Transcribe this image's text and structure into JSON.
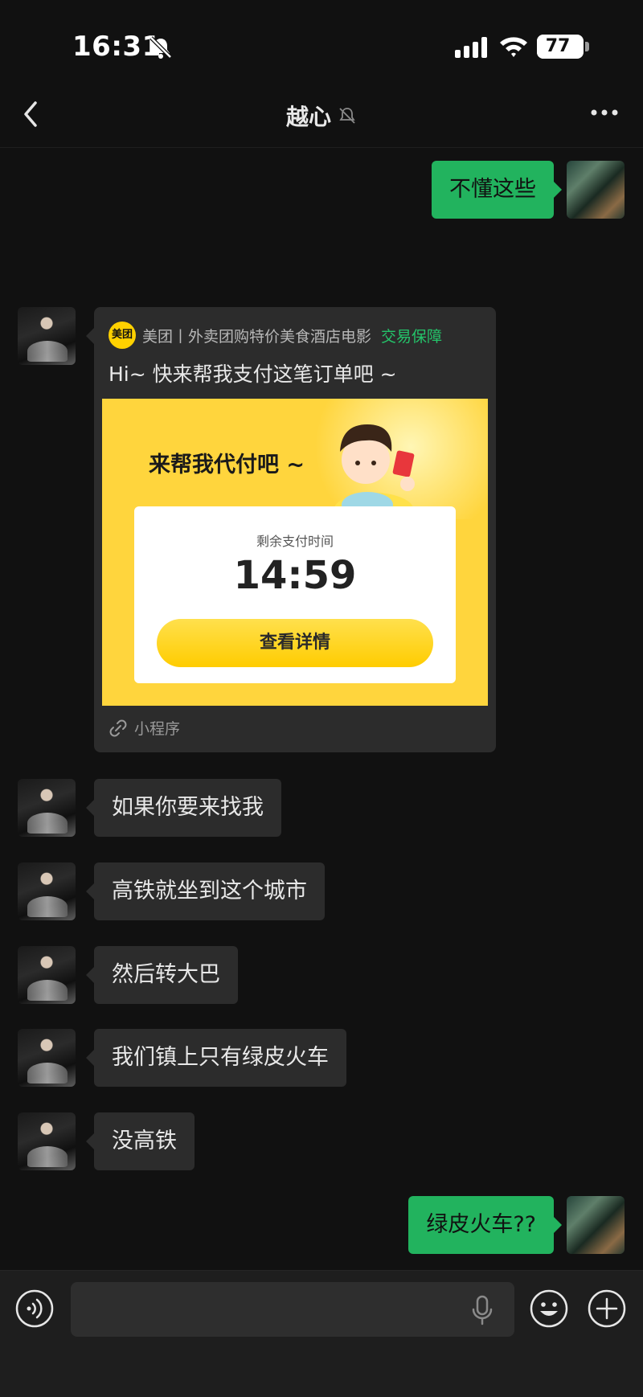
{
  "status_bar": {
    "time": "16:31",
    "battery": "77",
    "battery_level": 0.77,
    "icons": [
      "bell-slash-icon",
      "signal-icon",
      "wifi-icon",
      "battery-icon"
    ]
  },
  "nav": {
    "title": "越心",
    "icons": [
      "back-chevron-icon",
      "bell-slash-icon",
      "more-dots-icon"
    ]
  },
  "messages": [
    {
      "direction": "out",
      "text": "不懂这些"
    },
    {
      "direction": "in",
      "type": "mini_program_card"
    },
    {
      "direction": "in",
      "text": "如果你要来找我"
    },
    {
      "direction": "in",
      "text": "高铁就坐到这个城市"
    },
    {
      "direction": "in",
      "text": "然后转大巴"
    },
    {
      "direction": "in",
      "text": "我们镇上只有绿皮火车"
    },
    {
      "direction": "in",
      "text": "没高铁"
    },
    {
      "direction": "out",
      "text": "绿皮火车??"
    }
  ],
  "card": {
    "brand_logo": "美团",
    "brand_name": "美团丨外卖团购特价美食酒店电影",
    "guarantee": "交易保障",
    "message": "Hi~ 快来帮我支付这笔订单吧 ~",
    "promo_heading": "来帮我代付吧 ~",
    "timer_label": "剩余支付时间",
    "timer_value": "14:59",
    "button_label": "查看详情",
    "footer": "小程序"
  },
  "input_bar": {
    "placeholder": "",
    "icons": [
      "voice-icon",
      "microphone-icon",
      "emoji-icon",
      "plus-icon"
    ]
  },
  "colors": {
    "background": "#111111",
    "bubble_in": "#2c2c2c",
    "bubble_out": "#22b35e",
    "accent_green": "#24c46a",
    "meituan_yellow": "#ffd53d"
  }
}
